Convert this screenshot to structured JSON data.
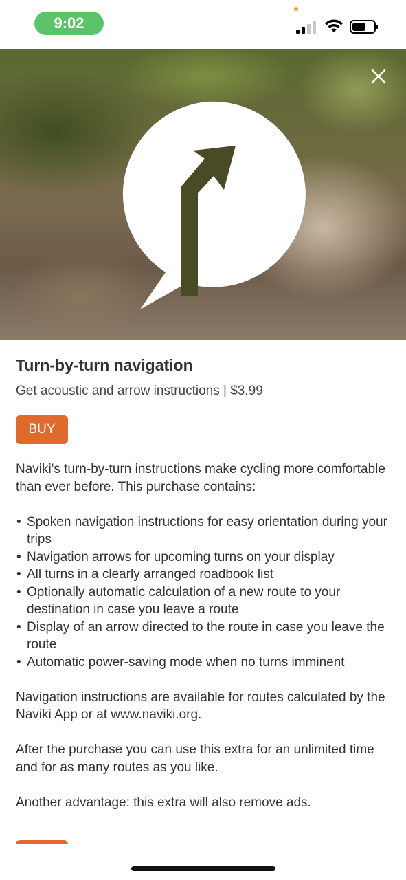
{
  "status_bar": {
    "time": "9:02",
    "accent_color": "#5dc36a"
  },
  "hero": {
    "icon": "turn-right-speech-bubble-icon",
    "close_icon": "close-icon"
  },
  "product": {
    "title": "Turn-by-turn navigation",
    "subtitle": "Get acoustic and arrow instructions | $3.99",
    "buy_label": "BUY",
    "buy_color": "#e0692d",
    "intro": "Naviki's turn-by-turn instructions make cycling more comfortable than ever before. This purchase contains:",
    "features": [
      "Spoken navigation instructions for easy orientation during your trips",
      "Navigation arrows for upcoming turns on your display",
      "All turns in a clearly arranged roadbook list",
      "Optionally automatic calculation of a new route to your destination in case you leave a route",
      "Display of an arrow directed to the route in case you leave the route",
      "Automatic power-saving mode when no turns imminent"
    ],
    "paragraph_routes": "Navigation instructions are available for routes calculated by the Naviki App or at www.naviki.org.",
    "paragraph_unlimited": "After the purchase you can use this extra for an unlimited time and for as many routes as you like.",
    "paragraph_ads": "Another advantage: this extra will also remove ads."
  }
}
